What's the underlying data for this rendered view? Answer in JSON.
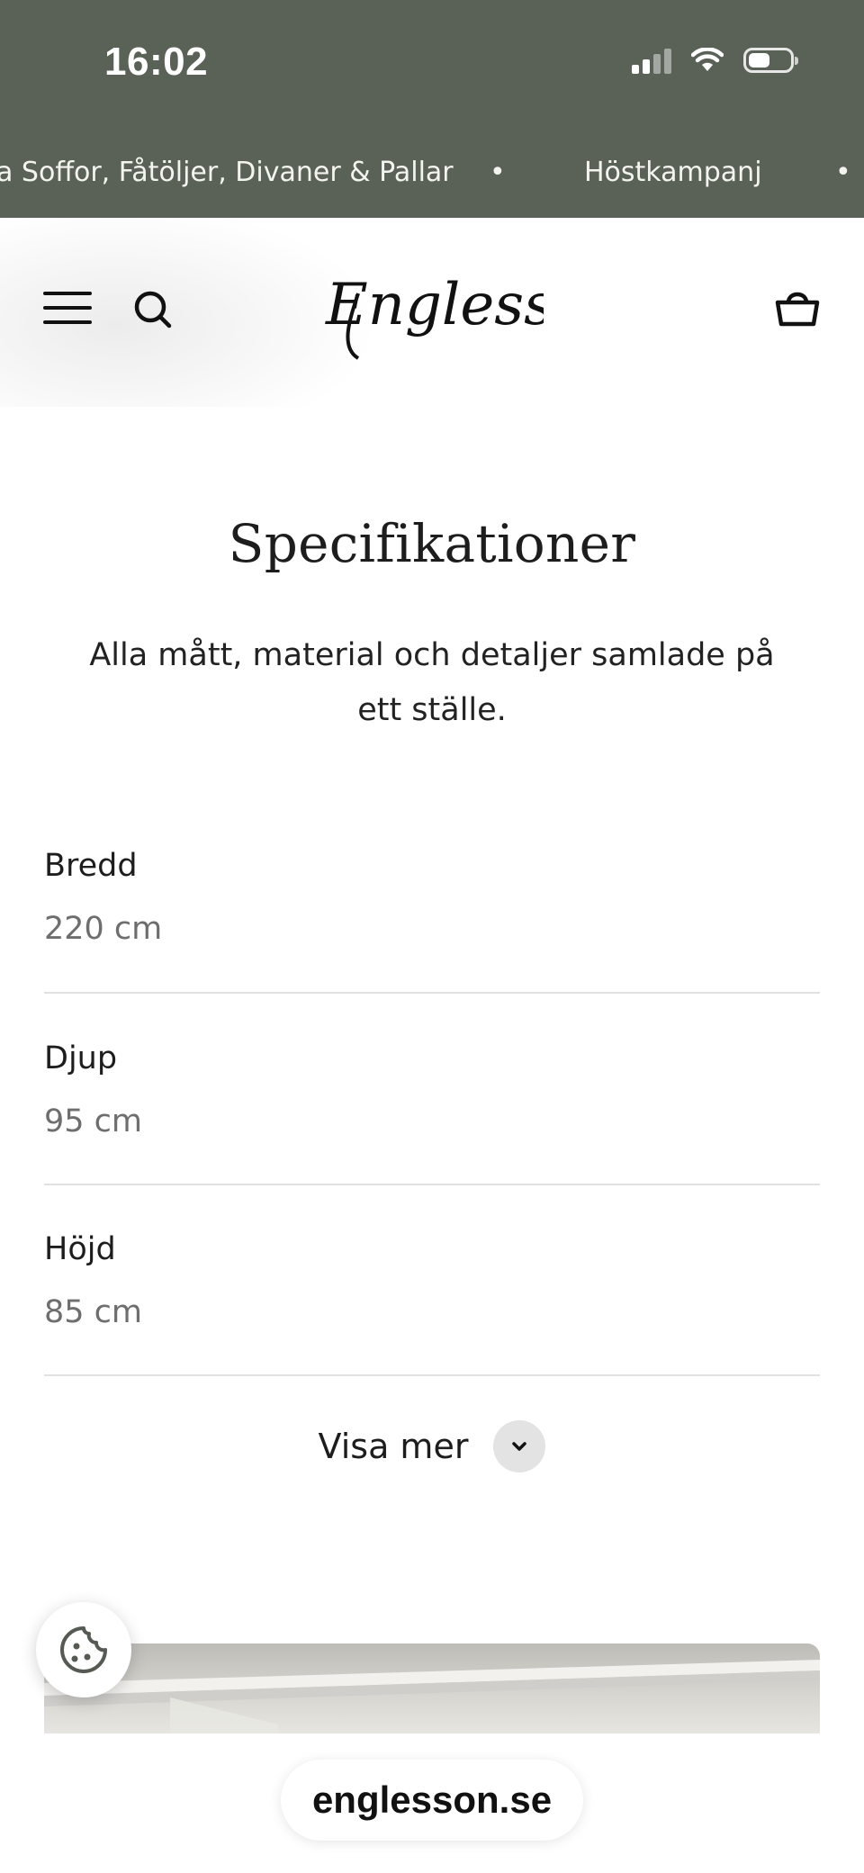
{
  "status_bar": {
    "time": "16:02",
    "signal_icon": "cellular-signal-icon",
    "wifi_icon": "wifi-icon",
    "battery_icon": "battery-icon",
    "battery_level": 0.45
  },
  "announcement_bar": {
    "items": [
      "a Soffor, Fåtöljer, Divaner & Pallar",
      "•",
      "Höstkampanj",
      "•"
    ]
  },
  "header": {
    "menu_icon": "hamburger-menu-icon",
    "search_icon": "search-icon",
    "logo_text": "Englesson",
    "cart_icon": "shopping-basket-icon"
  },
  "specifications": {
    "title": "Specifikationer",
    "subtitle": "Alla mått, material och detaljer samlade på ett ställe.",
    "rows": [
      {
        "label": "Bredd",
        "value": "220 cm"
      },
      {
        "label": "Djup",
        "value": "95 cm"
      },
      {
        "label": "Höjd",
        "value": "85 cm"
      }
    ],
    "show_more_label": "Visa mer",
    "show_more_icon": "chevron-down-icon"
  },
  "cookie_button": {
    "icon": "cookie-icon"
  },
  "browser": {
    "url": "englesson.se"
  },
  "colors": {
    "top_bar": "#5a6156",
    "divider": "#e1e1e1",
    "muted_text": "#6e6e6e"
  }
}
